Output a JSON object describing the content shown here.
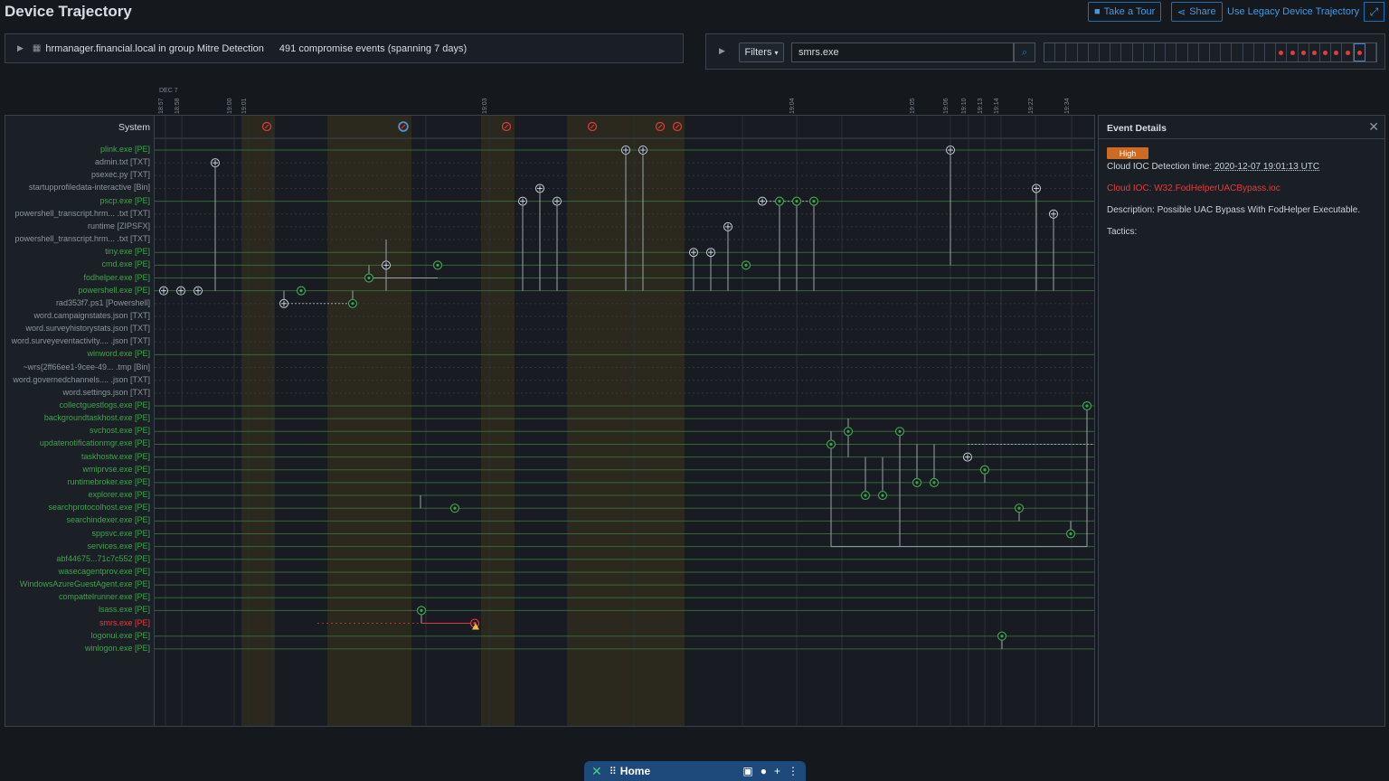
{
  "app": {
    "title": "Device Trajectory"
  },
  "toolbar": {
    "tour_label": "Take a Tour",
    "share_label": "Share",
    "legacy_link": "Use Legacy Device Trajectory"
  },
  "device": {
    "hostname": "hrmanager.financial.local in group Mitre Detection",
    "events": "491 compromise events (spanning 7 days)"
  },
  "filter": {
    "label": "Filters",
    "search_value": "smrs.exe"
  },
  "timeline": {
    "date_label": "DEC 7",
    "ticks": [
      "18:57",
      "18:58",
      "19:00",
      "19:01",
      "19:03",
      "19:04",
      "19:05",
      "19:06",
      "19:10",
      "19:13",
      "19:14",
      "19:22",
      "19:34"
    ]
  },
  "chart": {
    "system_label": "System"
  },
  "rows": [
    {
      "label": "plink.exe [PE]",
      "color": "#3fa34d"
    },
    {
      "label": "admin.txt [TXT]",
      "color": "#8b949e"
    },
    {
      "label": "psexec.py [TXT]",
      "color": "#8b949e"
    },
    {
      "label": "startupprofiledata-interactive [Bin]",
      "color": "#8b949e"
    },
    {
      "label": "pscp.exe [PE]",
      "color": "#3fa34d"
    },
    {
      "label": "powershell_transcript.hrm... .txt [TXT]",
      "color": "#8b949e"
    },
    {
      "label": "runtime [ZIPSFX]",
      "color": "#8b949e"
    },
    {
      "label": "powershell_transcript.hrm... .txt [TXT]",
      "color": "#8b949e"
    },
    {
      "label": "tiny.exe [PE]",
      "color": "#3fa34d"
    },
    {
      "label": "cmd.exe [PE]",
      "color": "#3fa34d"
    },
    {
      "label": "fodhelper.exe [PE]",
      "color": "#3fa34d"
    },
    {
      "label": "powershell.exe [PE]",
      "color": "#3fa34d"
    },
    {
      "label": "rad353f7.ps1 [Powershell]",
      "color": "#8b949e"
    },
    {
      "label": "word.campaignstates.json [TXT]",
      "color": "#8b949e"
    },
    {
      "label": "word.surveyhistorystats.json [TXT]",
      "color": "#8b949e"
    },
    {
      "label": "word.surveyeventactivity.... .json [TXT]",
      "color": "#8b949e"
    },
    {
      "label": "winword.exe [PE]",
      "color": "#3fa34d"
    },
    {
      "label": "~wrs{2ff66ee1-9cee-49... .tmp [Bin]",
      "color": "#8b949e"
    },
    {
      "label": "word.governedchannels.... .json [TXT]",
      "color": "#8b949e"
    },
    {
      "label": "word.settings.json [TXT]",
      "color": "#8b949e"
    },
    {
      "label": "collectguestlogs.exe [PE]",
      "color": "#3fa34d"
    },
    {
      "label": "backgroundtaskhost.exe [PE]",
      "color": "#3fa34d"
    },
    {
      "label": "svchost.exe [PE]",
      "color": "#3fa34d"
    },
    {
      "label": "updatenotificationmgr.exe [PE]",
      "color": "#3fa34d"
    },
    {
      "label": "taskhostw.exe [PE]",
      "color": "#3fa34d"
    },
    {
      "label": "wmiprvse.exe [PE]",
      "color": "#3fa34d"
    },
    {
      "label": "runtimebroker.exe [PE]",
      "color": "#3fa34d"
    },
    {
      "label": "explorer.exe [PE]",
      "color": "#3fa34d"
    },
    {
      "label": "searchprotocolhost.exe [PE]",
      "color": "#3fa34d"
    },
    {
      "label": "searchindexer.exe [PE]",
      "color": "#3fa34d"
    },
    {
      "label": "sppsvc.exe [PE]",
      "color": "#3fa34d"
    },
    {
      "label": "services.exe [PE]",
      "color": "#3fa34d"
    },
    {
      "label": "abf44675...71c7c552 [PE]",
      "color": "#3fa34d"
    },
    {
      "label": "wasecagentprov.exe [PE]",
      "color": "#3fa34d"
    },
    {
      "label": "WindowsAzureGuestAgent.exe [PE]",
      "color": "#3fa34d"
    },
    {
      "label": "compattelrunner.exe [PE]",
      "color": "#3fa34d"
    },
    {
      "label": "lsass.exe [PE]",
      "color": "#3fa34d"
    },
    {
      "label": "smrs.exe [PE]",
      "color": "#e23c3c"
    },
    {
      "label": "logonui.exe [PE]",
      "color": "#3fa34d"
    },
    {
      "label": "winlogon.exe [PE]",
      "color": "#3fa34d"
    }
  ],
  "details": {
    "title": "Event Details",
    "severity": "High",
    "detection_label": "Cloud IOC Detection time:",
    "detection_time": "2020-12-07 19:01:13 UTC",
    "ioc": "Cloud IOC: W32.FodHelperUACBypass.ioc",
    "description": "Description: Possible UAC Bypass With FodHelper Executable.",
    "tactics": "Tactics:"
  },
  "taskbar": {
    "home_label": "Home"
  },
  "colors": {
    "accent": "#3f9ae6",
    "process": "#3fa34d",
    "alert": "#e23c3c",
    "severity_high": "#d06a23",
    "highlight_band": "#3a3220"
  }
}
